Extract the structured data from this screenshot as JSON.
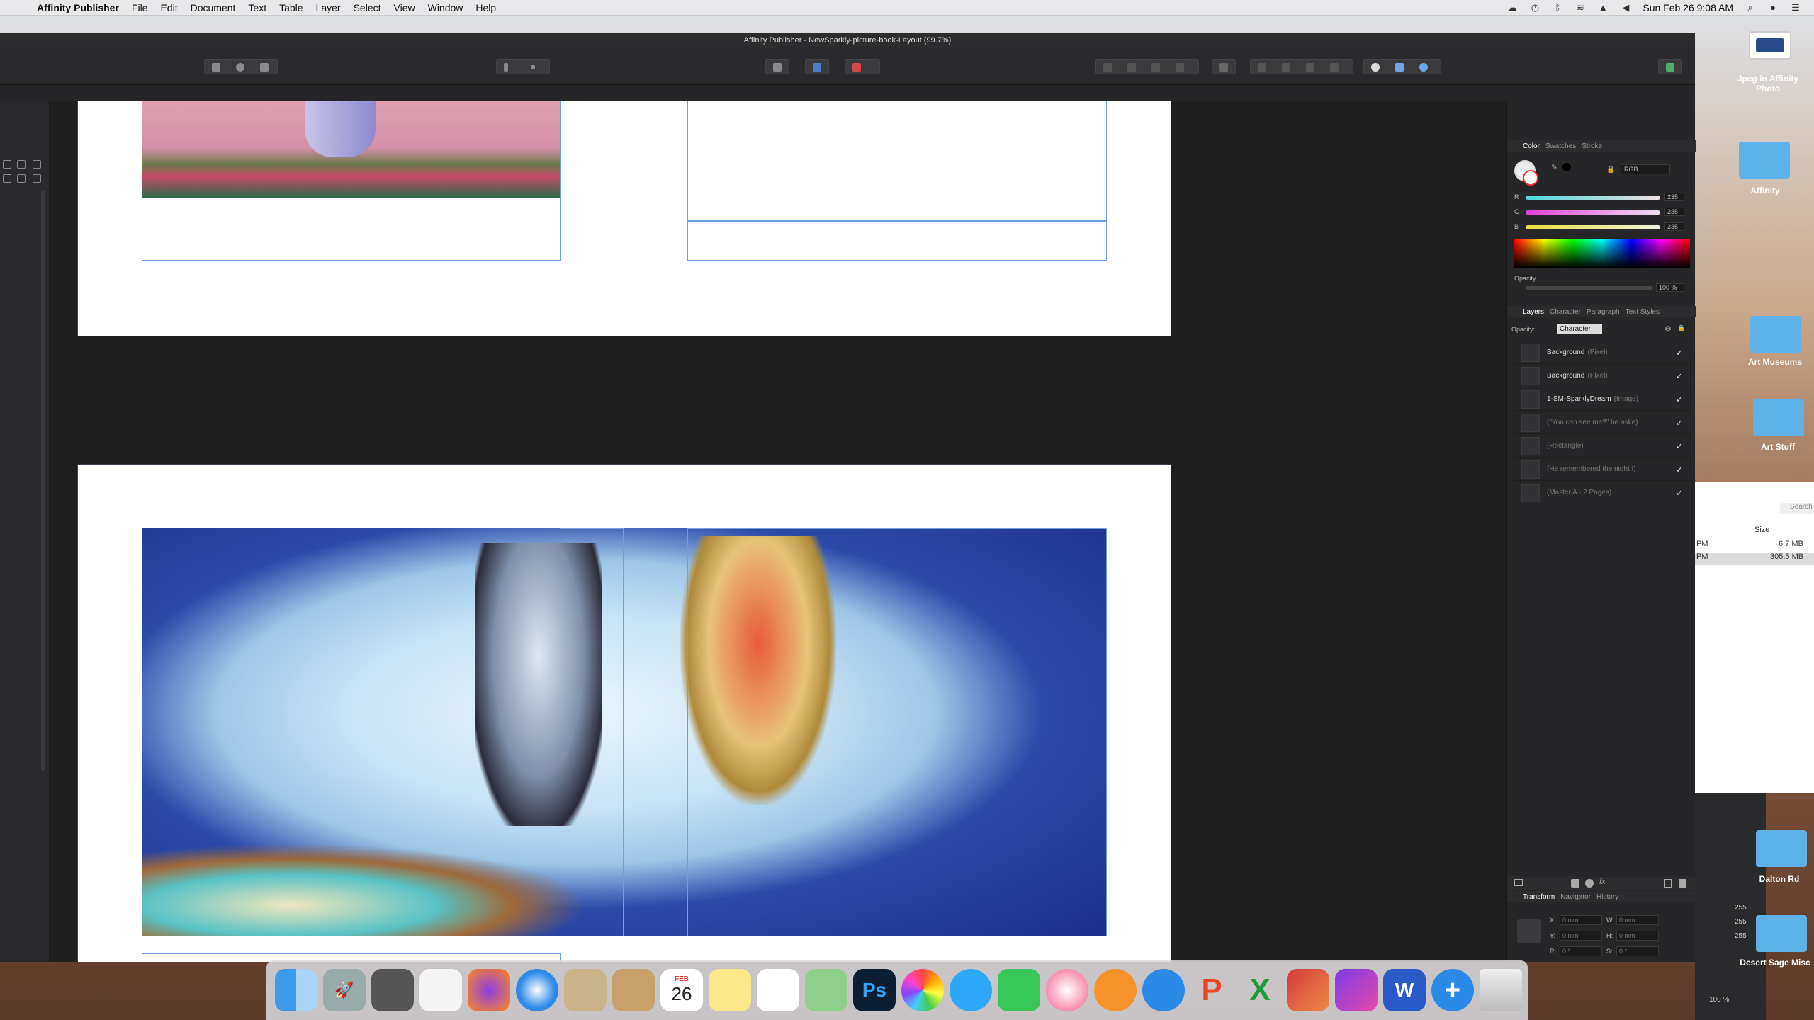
{
  "menubar": {
    "app_name": "Affinity Publisher",
    "menus": [
      "File",
      "Edit",
      "Document",
      "Text",
      "Table",
      "Layer",
      "Select",
      "View",
      "Window",
      "Help"
    ],
    "clock": "Sun Feb 26  9:08 AM"
  },
  "window": {
    "title": "Affinity Publisher - NewSparkly-picture-book-Layout (99.7%)"
  },
  "color_panel": {
    "tabs": [
      "Color",
      "Swatches",
      "Stroke"
    ],
    "model": "RGB",
    "sliders": [
      {
        "label": "R",
        "value": "235",
        "fill": 0.92
      },
      {
        "label": "G",
        "value": "235",
        "fill": 0.92
      },
      {
        "label": "B",
        "value": "235",
        "fill": 0.92
      }
    ],
    "opacity_label": "Opacity",
    "opacity_value": "100 %"
  },
  "layers_panel": {
    "tabs": [
      "Layers",
      "Character",
      "Paragraph",
      "Text Styles"
    ],
    "opacity_label": "Opacity:",
    "dropdown": "Character",
    "layers": [
      {
        "name": "Background",
        "type": "(Pixel)",
        "dim": false
      },
      {
        "name": "Background",
        "type": "(Pixel)",
        "dim": false
      },
      {
        "name": "1-SM-SparklyDream",
        "type": "(Image)",
        "dim": false
      },
      {
        "name": "(\"You can see me?\" he aske)",
        "type": "",
        "dim": true
      },
      {
        "name": "(Rectangle)",
        "type": "",
        "dim": true
      },
      {
        "name": "(He remembered the night I)",
        "type": "",
        "dim": true
      },
      {
        "name": "(Master A - 2 Pages)",
        "type": "",
        "dim": true
      }
    ]
  },
  "transform_panel": {
    "tabs": [
      "Transform",
      "Navigator",
      "History"
    ],
    "fields": [
      {
        "label": "X:",
        "value": "0 mm"
      },
      {
        "label": "W:",
        "value": "0 mm"
      },
      {
        "label": "Y:",
        "value": "0 mm"
      },
      {
        "label": "H:",
        "value": "0 mm"
      },
      {
        "label": "R:",
        "value": "0 °"
      },
      {
        "label": "S:",
        "value": "0 °"
      }
    ]
  },
  "desktop": {
    "items": [
      "Jpeg in Affinity Photo",
      "Affinity",
      "Art Museums",
      "Art Stuff",
      "Dalton Rd",
      "Desert Sage Misc"
    ],
    "finder_col": "Size",
    "finder_sizes": [
      "6.7 MB",
      "305.5 MB"
    ],
    "finder_times": [
      "PM",
      "PM"
    ],
    "search": "Search",
    "behind_values": [
      "255",
      "255",
      "255"
    ],
    "behind_zoom": "100 %"
  },
  "dock": {
    "calendar_month": "FEB",
    "calendar_day": "26"
  }
}
